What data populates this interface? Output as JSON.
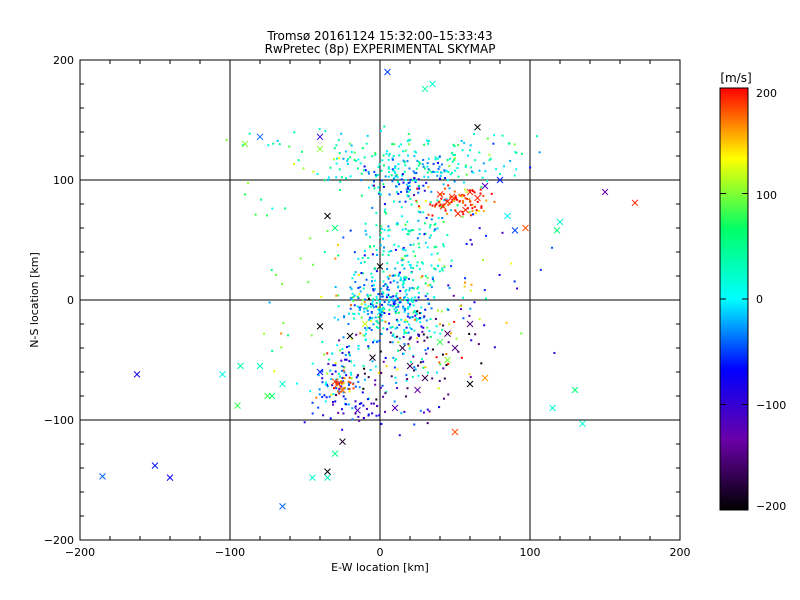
{
  "chart_data": {
    "type": "scatter",
    "title": "Tromsø 20161124 15:32:00–15:33:43",
    "subtitle": "RwPretec (8p) EXPERIMENTAL SKYMAP",
    "xlabel": "E-W location [km]",
    "ylabel": "N-S location [km]",
    "xlim": [
      -200,
      200
    ],
    "ylim": [
      -200,
      200
    ],
    "xticks": [
      "−200",
      "−100",
      "0",
      "100",
      "200"
    ],
    "yticks": [
      "200",
      "100",
      "0",
      "−100",
      "−200"
    ],
    "grid": true,
    "colorbar": {
      "label": "[m/s]",
      "range": [
        -200,
        200
      ],
      "ticks": [
        "200",
        "100",
        "0",
        "−100",
        "−200"
      ],
      "colormap": [
        "#000000",
        "#6a00a8",
        "#0000ff",
        "#00ffff",
        "#00ff66",
        "#ffff00",
        "#ff0000"
      ]
    },
    "clusters": [
      {
        "cx": 50,
        "cy": 82,
        "sx": 12,
        "sy": 6,
        "n": 90,
        "v": 185
      },
      {
        "cx": 25,
        "cy": 110,
        "sx": 28,
        "sy": 9,
        "n": 180,
        "v": 10
      },
      {
        "cx": 20,
        "cy": 95,
        "sx": 10,
        "sy": 6,
        "n": 40,
        "v": -40
      },
      {
        "cx": 10,
        "cy": 130,
        "sx": 55,
        "sy": 6,
        "n": 60,
        "v": 40
      },
      {
        "cx": 20,
        "cy": 45,
        "sx": 20,
        "sy": 25,
        "n": 160,
        "v": 20
      },
      {
        "cx": 5,
        "cy": 0,
        "sx": 14,
        "sy": 14,
        "n": 240,
        "v": -20
      },
      {
        "cx": 0,
        "cy": -30,
        "sx": 18,
        "sy": 25,
        "n": 110,
        "v": 0
      },
      {
        "cx": -30,
        "cy": -70,
        "sx": 10,
        "sy": 14,
        "n": 70,
        "v": -40
      },
      {
        "cx": -25,
        "cy": -72,
        "sx": 4,
        "sy": 3,
        "n": 25,
        "v": 175
      },
      {
        "cx": 25,
        "cy": -50,
        "sx": 20,
        "sy": 20,
        "n": 70,
        "v": -150
      },
      {
        "cx": -5,
        "cy": -90,
        "sx": 18,
        "sy": 8,
        "n": 50,
        "v": -90
      },
      {
        "cx": -20,
        "cy": -15,
        "sx": 30,
        "sy": 30,
        "n": 50,
        "v": 110
      },
      {
        "cx": 35,
        "cy": -20,
        "sx": 25,
        "sy": 25,
        "n": 40,
        "v": 140
      },
      {
        "cx": -60,
        "cy": 80,
        "sx": 20,
        "sy": 40,
        "n": 30,
        "v": 70
      },
      {
        "cx": 60,
        "cy": 20,
        "sx": 30,
        "sy": 60,
        "n": 40,
        "v": -60
      }
    ],
    "markers": [
      {
        "x": 170,
        "y": 81,
        "v": 190
      },
      {
        "x": 120,
        "y": 65,
        "v": 20
      },
      {
        "x": 118,
        "y": 58,
        "v": 60
      },
      {
        "x": 97,
        "y": 60,
        "v": 180
      },
      {
        "x": 90,
        "y": 58,
        "v": -50
      },
      {
        "x": 85,
        "y": 70,
        "v": 0
      },
      {
        "x": 150,
        "y": 90,
        "v": -130
      },
      {
        "x": 65,
        "y": 144,
        "v": -200
      },
      {
        "x": 30,
        "y": 176,
        "v": 40
      },
      {
        "x": 35,
        "y": 180,
        "v": 20
      },
      {
        "x": 5,
        "y": 190,
        "v": -50
      },
      {
        "x": -80,
        "y": 136,
        "v": -40
      },
      {
        "x": -40,
        "y": 126,
        "v": 100
      },
      {
        "x": -40,
        "y": 136,
        "v": -90
      },
      {
        "x": -90,
        "y": 130,
        "v": 100
      },
      {
        "x": -162,
        "y": -62,
        "v": -80
      },
      {
        "x": -150,
        "y": -138,
        "v": -60
      },
      {
        "x": -140,
        "y": -148,
        "v": -70
      },
      {
        "x": -185,
        "y": -147,
        "v": -40
      },
      {
        "x": -65,
        "y": -172,
        "v": -40
      },
      {
        "x": -45,
        "y": -148,
        "v": 20
      },
      {
        "x": -35,
        "y": -148,
        "v": 30
      },
      {
        "x": -30,
        "y": -128,
        "v": 50
      },
      {
        "x": -35,
        "y": -143,
        "v": -200
      },
      {
        "x": -25,
        "y": -118,
        "v": -180
      },
      {
        "x": 115,
        "y": -90,
        "v": 20
      },
      {
        "x": 130,
        "y": -75,
        "v": 60
      },
      {
        "x": 135,
        "y": -103,
        "v": 20
      },
      {
        "x": 70,
        "y": -65,
        "v": 160
      },
      {
        "x": 50,
        "y": -110,
        "v": 180
      },
      {
        "x": 60,
        "y": -70,
        "v": -200
      },
      {
        "x": -95,
        "y": -88,
        "v": 80
      },
      {
        "x": -93,
        "y": -55,
        "v": 40
      },
      {
        "x": -105,
        "y": -62,
        "v": 10
      },
      {
        "x": -80,
        "y": -55,
        "v": 30
      },
      {
        "x": -72,
        "y": -80,
        "v": 60
      },
      {
        "x": -65,
        "y": -70,
        "v": 20
      },
      {
        "x": -75,
        "y": -80,
        "v": 80
      },
      {
        "x": 45,
        "y": 82,
        "v": 190
      },
      {
        "x": 48,
        "y": 86,
        "v": 190
      },
      {
        "x": 57,
        "y": 75,
        "v": 190
      },
      {
        "x": 42,
        "y": 78,
        "v": 190
      },
      {
        "x": 60,
        "y": 90,
        "v": 190
      },
      {
        "x": 65,
        "y": 85,
        "v": 190
      },
      {
        "x": 52,
        "y": 72,
        "v": 190
      },
      {
        "x": 40,
        "y": 88,
        "v": 190
      },
      {
        "x": 80,
        "y": 100,
        "v": -60
      },
      {
        "x": 70,
        "y": 95,
        "v": -110
      },
      {
        "x": -35,
        "y": 70,
        "v": -200
      },
      {
        "x": -30,
        "y": 60,
        "v": 60
      },
      {
        "x": 0,
        "y": 28,
        "v": -200
      },
      {
        "x": 15,
        "y": -40,
        "v": -170
      },
      {
        "x": 20,
        "y": -55,
        "v": -170
      },
      {
        "x": 30,
        "y": -65,
        "v": -170
      },
      {
        "x": -20,
        "y": -30,
        "v": -200
      },
      {
        "x": -40,
        "y": -22,
        "v": -200
      },
      {
        "x": -5,
        "y": -48,
        "v": -190
      },
      {
        "x": 45,
        "y": -28,
        "v": -160
      },
      {
        "x": 50,
        "y": -40,
        "v": -150
      },
      {
        "x": 60,
        "y": -20,
        "v": -150
      },
      {
        "x": 10,
        "y": -90,
        "v": -120
      },
      {
        "x": -15,
        "y": -92,
        "v": -110
      },
      {
        "x": -40,
        "y": -60,
        "v": -60
      },
      {
        "x": -30,
        "y": -68,
        "v": 180
      },
      {
        "x": -25,
        "y": -75,
        "v": 170
      },
      {
        "x": -28,
        "y": -70,
        "v": 190
      },
      {
        "x": 20,
        "y": 0,
        "v": 10
      },
      {
        "x": 0,
        "y": -10,
        "v": 0
      },
      {
        "x": -10,
        "y": -20,
        "v": 120
      },
      {
        "x": 40,
        "y": -35,
        "v": 80
      },
      {
        "x": 45,
        "y": -50,
        "v": 100
      },
      {
        "x": 25,
        "y": -75,
        "v": -130
      }
    ]
  }
}
